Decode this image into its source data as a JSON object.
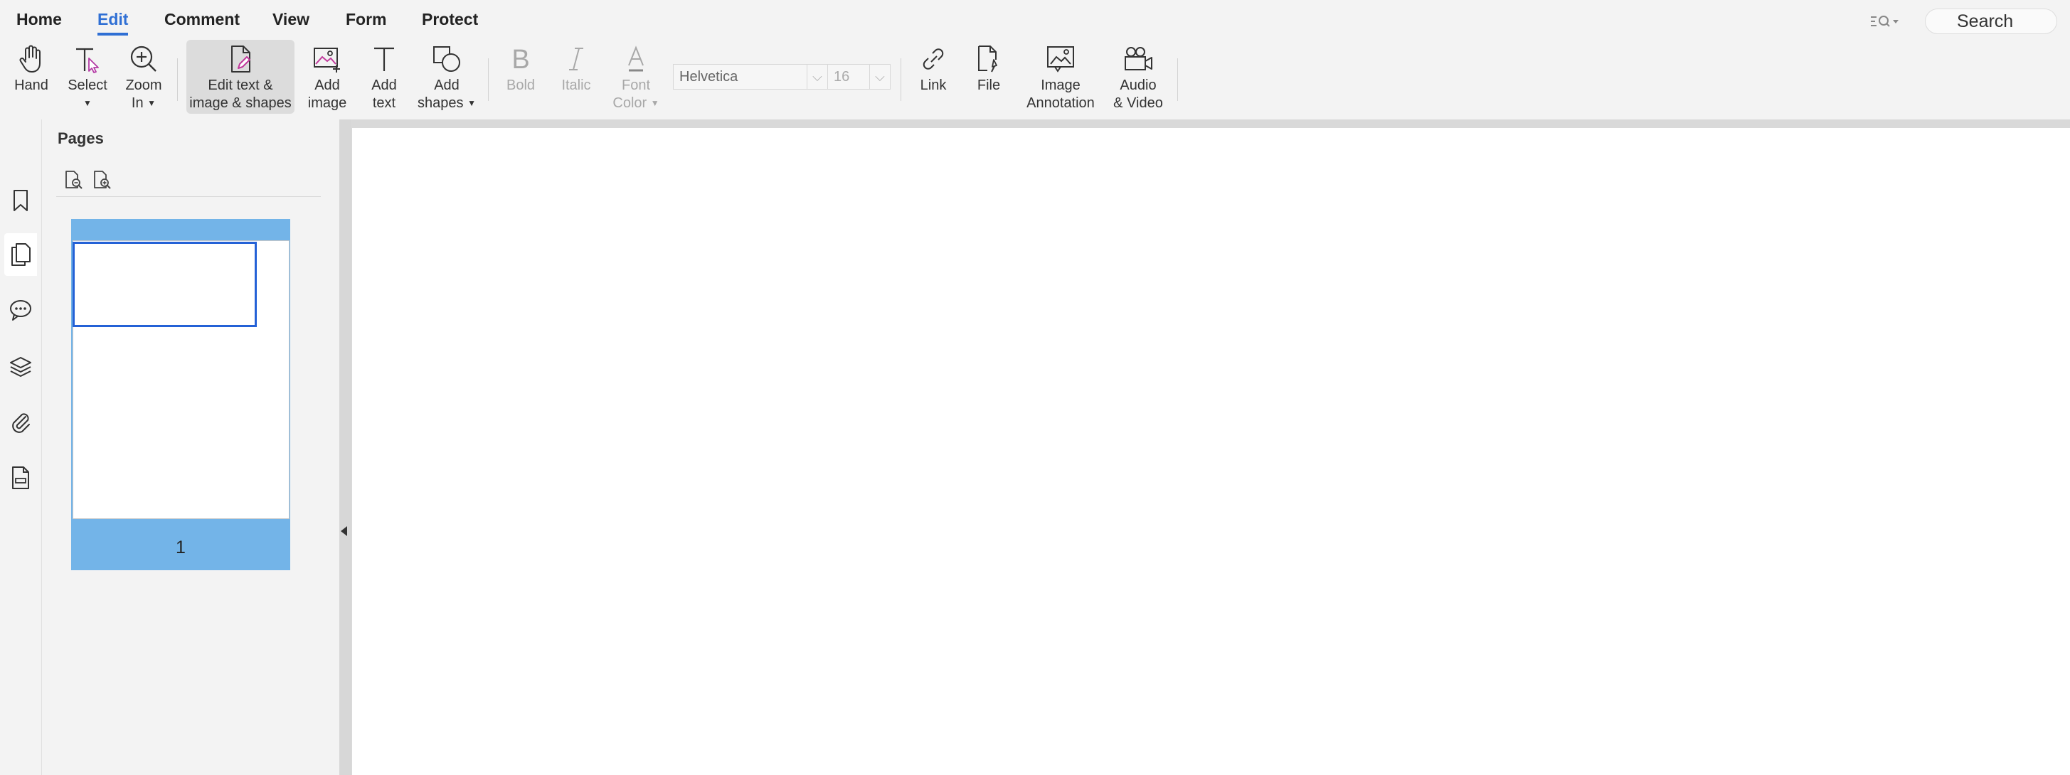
{
  "menu": {
    "tabs": [
      {
        "label": "Home"
      },
      {
        "label": "Edit"
      },
      {
        "label": "Comment"
      },
      {
        "label": "View"
      },
      {
        "label": "Form"
      },
      {
        "label": "Protect"
      }
    ],
    "active_tab": "Edit"
  },
  "search": {
    "value": "Search",
    "options_icon": "search-options-icon"
  },
  "toolbar": {
    "hand": {
      "label": "Hand"
    },
    "select": {
      "label": "Select"
    },
    "zoom": {
      "label_1": "Zoom",
      "label_2": "In"
    },
    "edit_all": {
      "label_1": "Edit text &",
      "label_2": "image & shapes"
    },
    "add_image": {
      "label_1": "Add",
      "label_2": "image"
    },
    "add_text": {
      "label_1": "Add",
      "label_2": "text"
    },
    "add_shapes": {
      "label_1": "Add",
      "label_2": "shapes"
    },
    "bold": {
      "label": "Bold"
    },
    "italic": {
      "label": "Italic"
    },
    "font_color": {
      "label_1": "Font",
      "label_2": "Color"
    },
    "font_family": "Helvetica",
    "font_size": "16",
    "link": {
      "label": "Link"
    },
    "file": {
      "label": "File"
    },
    "image_annotation": {
      "label_1": "Image",
      "label_2": "Annotation"
    },
    "audio_video": {
      "label_1": "Audio",
      "label_2": "& Video"
    }
  },
  "sidebar": {
    "rail": [
      "bookmark-icon",
      "pages-icon",
      "comments-icon",
      "layers-icon",
      "attachments-icon",
      "form-fields-icon"
    ],
    "active": "pages-icon"
  },
  "pages_panel": {
    "title": "Pages",
    "thumbnails": [
      {
        "page_number": "1"
      }
    ]
  },
  "colors": {
    "accent": "#2f6fd4",
    "thumbnail_selected": "#73b4e8",
    "viewport_frame": "#2461d6",
    "edit_icon_accent": "#c0399b"
  }
}
